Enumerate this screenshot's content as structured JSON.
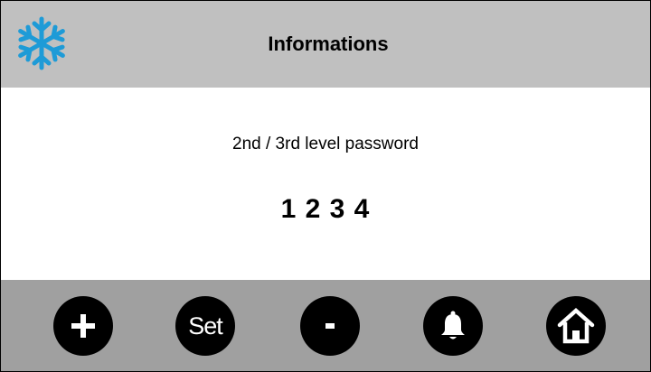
{
  "header": {
    "title": "Informations",
    "logo_icon": "snowflake-icon",
    "logo_color": "#1e9bd7"
  },
  "content": {
    "label": "2nd / 3rd level password",
    "value": "1 2 3 4"
  },
  "footer": {
    "buttons": [
      {
        "name": "plus-button",
        "icon": "plus-icon"
      },
      {
        "name": "set-button",
        "icon": "text",
        "label": "Set"
      },
      {
        "name": "minus-button",
        "icon": "minus-icon"
      },
      {
        "name": "alarm-button",
        "icon": "bell-icon"
      },
      {
        "name": "home-button",
        "icon": "home-icon"
      }
    ]
  },
  "colors": {
    "header_bg": "#c0c0c0",
    "footer_bg": "#a0a0a0",
    "button_bg": "#000000",
    "button_fg": "#ffffff"
  }
}
